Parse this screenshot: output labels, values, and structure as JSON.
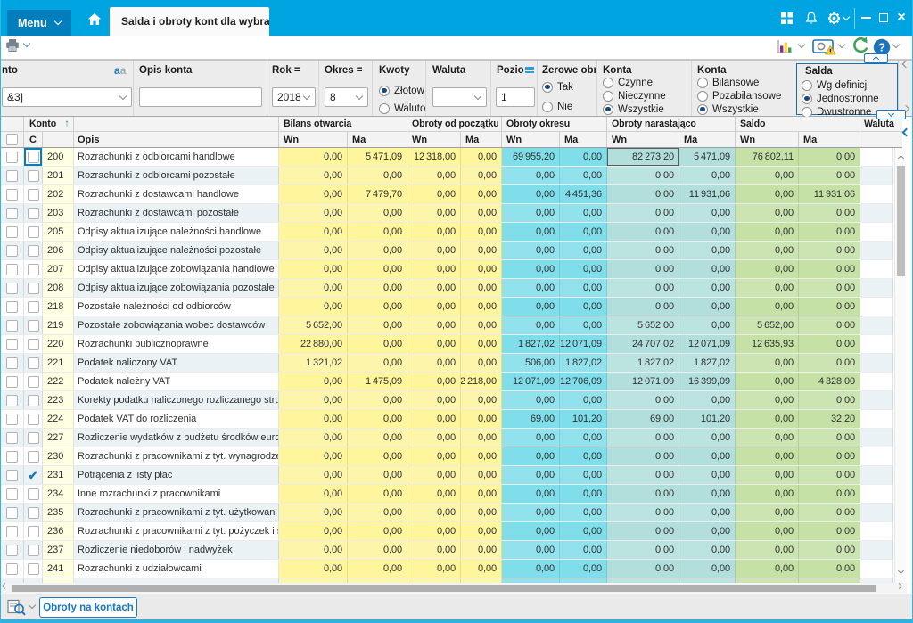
{
  "titlebar": {
    "menu_label": "Menu",
    "tab_title": "Salda i obroty kont dla wybra"
  },
  "filters": {
    "konto": {
      "label": "nto",
      "value": "&3]"
    },
    "opis_konta": {
      "label": "Opis konta",
      "value": ""
    },
    "rok": {
      "label": "Rok =",
      "value": "2018"
    },
    "okres": {
      "label": "Okres =",
      "value": "8"
    },
    "kwoty": {
      "label": "Kwoty",
      "options": [
        "Złotow",
        "Waluto"
      ],
      "selected": "Złotow"
    },
    "waluta": {
      "label": "Waluta",
      "value": ""
    },
    "poziom": {
      "label": "Pozio",
      "value": "1"
    },
    "zerowe_obroty": {
      "label": "Zerowe obro",
      "options": [
        "Tak",
        "Nie"
      ],
      "selected": "Tak"
    },
    "konta_aktywnosc": {
      "label": "Konta",
      "options": [
        "Czynne",
        "Nieczynne",
        "Wszystkie"
      ],
      "selected": "Wszystkie"
    },
    "konta_typ": {
      "label": "Konta",
      "options": [
        "Bilansowe",
        "Pozabilansowe",
        "Wszystkie"
      ],
      "selected": "Wszystkie"
    },
    "salda": {
      "label": "Salda",
      "options": [
        "Wg definicji",
        "Jednostronne",
        "Dwustronne"
      ],
      "selected": "Jednostronne"
    }
  },
  "table": {
    "groups": {
      "konto": "Konto",
      "bilans_otwarcia": "Bilans otwarcia",
      "obroty_od_poczatku": "Obroty od początku r",
      "obroty_okresu": "Obroty okresu",
      "obroty_narastajaco": "Obroty narastająco",
      "saldo": "Saldo",
      "waluta": "Waluta"
    },
    "subheaders": {
      "c": "C",
      "opis": "Opis",
      "wn": "Wn",
      "ma": "Ma"
    },
    "focused_account": "200",
    "checked_account": "231",
    "rows": [
      {
        "konto": "200",
        "opis": "Rozrachunki z odbiorcami handlowe",
        "values": [
          "0,00",
          "5 471,09",
          "12 318,00",
          "0,00",
          "69 955,20",
          "0,00",
          "82 273,20",
          "5 471,09",
          "76 802,11",
          "0,00"
        ]
      },
      {
        "konto": "201",
        "opis": "Rozrachunki z odbiorcami pozostałe",
        "values": [
          "0,00",
          "0,00",
          "0,00",
          "0,00",
          "0,00",
          "0,00",
          "0,00",
          "0,00",
          "0,00",
          "0,00"
        ]
      },
      {
        "konto": "202",
        "opis": "Rozrachunki z dostawcami handlowe",
        "values": [
          "0,00",
          "7 479,70",
          "0,00",
          "0,00",
          "0,00",
          "4 451,36",
          "0,00",
          "11 931,06",
          "0,00",
          "11 931,06"
        ]
      },
      {
        "konto": "203",
        "opis": "Rozrachunki z dostawcami pozostałe",
        "values": [
          "0,00",
          "0,00",
          "0,00",
          "0,00",
          "0,00",
          "0,00",
          "0,00",
          "0,00",
          "0,00",
          "0,00"
        ]
      },
      {
        "konto": "205",
        "opis": "Odpisy aktualizujące należności handlowe",
        "values": [
          "0,00",
          "0,00",
          "0,00",
          "0,00",
          "0,00",
          "0,00",
          "0,00",
          "0,00",
          "0,00",
          "0,00"
        ]
      },
      {
        "konto": "206",
        "opis": "Odpisy aktualizujące należności pozostałe",
        "values": [
          "0,00",
          "0,00",
          "0,00",
          "0,00",
          "0,00",
          "0,00",
          "0,00",
          "0,00",
          "0,00",
          "0,00"
        ]
      },
      {
        "konto": "207",
        "opis": "Odpisy aktualizujące zobowiązania handlowe",
        "values": [
          "0,00",
          "0,00",
          "0,00",
          "0,00",
          "0,00",
          "0,00",
          "0,00",
          "0,00",
          "0,00",
          "0,00"
        ]
      },
      {
        "konto": "208",
        "opis": "Odpisy aktualizujące zobowiązania pozostałe",
        "values": [
          "0,00",
          "0,00",
          "0,00",
          "0,00",
          "0,00",
          "0,00",
          "0,00",
          "0,00",
          "0,00",
          "0,00"
        ]
      },
      {
        "konto": "218",
        "opis": "Pozostałe należności od odbiorców",
        "values": [
          "0,00",
          "0,00",
          "0,00",
          "0,00",
          "0,00",
          "0,00",
          "0,00",
          "0,00",
          "0,00",
          "0,00"
        ]
      },
      {
        "konto": "219",
        "opis": "Pozostałe zobowiązania wobec dostawców",
        "values": [
          "5 652,00",
          "0,00",
          "0,00",
          "0,00",
          "0,00",
          "0,00",
          "5 652,00",
          "0,00",
          "5 652,00",
          "0,00"
        ]
      },
      {
        "konto": "220",
        "opis": "Rozrachunki publicznoprawne",
        "values": [
          "22 880,00",
          "0,00",
          "0,00",
          "0,00",
          "1 827,02",
          "12 071,09",
          "24 707,02",
          "12 071,09",
          "12 635,93",
          "0,00"
        ]
      },
      {
        "konto": "221",
        "opis": "Podatek naliczony VAT",
        "values": [
          "1 321,02",
          "0,00",
          "0,00",
          "0,00",
          "506,00",
          "1 827,02",
          "1 827,02",
          "1 827,02",
          "0,00",
          "0,00"
        ]
      },
      {
        "konto": "222",
        "opis": "Podatek należny VAT",
        "values": [
          "0,00",
          "1 475,09",
          "0,00",
          "2 218,00",
          "12 071,09",
          "12 706,09",
          "12 071,09",
          "16 399,09",
          "0,00",
          "4 328,00"
        ]
      },
      {
        "konto": "223",
        "opis": "Korekty podatku naliczonego rozliczanego stru",
        "values": [
          "0,00",
          "0,00",
          "0,00",
          "0,00",
          "0,00",
          "0,00",
          "0,00",
          "0,00",
          "0,00",
          "0,00"
        ]
      },
      {
        "konto": "224",
        "opis": "Podatek VAT do rozliczenia",
        "values": [
          "0,00",
          "0,00",
          "0,00",
          "0,00",
          "69,00",
          "101,20",
          "69,00",
          "101,20",
          "0,00",
          "32,20"
        ]
      },
      {
        "konto": "227",
        "opis": "Rozliczenie wydatków z budżetu środków euro",
        "values": [
          "0,00",
          "0,00",
          "0,00",
          "0,00",
          "0,00",
          "0,00",
          "0,00",
          "0,00",
          "0,00",
          "0,00"
        ]
      },
      {
        "konto": "230",
        "opis": "Rozrachunki z pracownikami z tyt. wynagrodze",
        "values": [
          "0,00",
          "0,00",
          "0,00",
          "0,00",
          "0,00",
          "0,00",
          "0,00",
          "0,00",
          "0,00",
          "0,00"
        ]
      },
      {
        "konto": "231",
        "opis": "Potrącenia z listy płac",
        "checked": true,
        "values": [
          "0,00",
          "0,00",
          "0,00",
          "0,00",
          "0,00",
          "0,00",
          "0,00",
          "0,00",
          "0,00",
          "0,00"
        ]
      },
      {
        "konto": "234",
        "opis": "Inne rozrachunki z pracownikami",
        "values": [
          "0,00",
          "0,00",
          "0,00",
          "0,00",
          "0,00",
          "0,00",
          "0,00",
          "0,00",
          "0,00",
          "0,00"
        ]
      },
      {
        "konto": "235",
        "opis": "Rozrachunki z pracownikami z tyt. użytkowani",
        "values": [
          "0,00",
          "0,00",
          "0,00",
          "0,00",
          "0,00",
          "0,00",
          "0,00",
          "0,00",
          "0,00",
          "0,00"
        ]
      },
      {
        "konto": "236",
        "opis": "Rozrachunki z pracownikami z tyt. pożyczek i s",
        "values": [
          "0,00",
          "0,00",
          "0,00",
          "0,00",
          "0,00",
          "0,00",
          "0,00",
          "0,00",
          "0,00",
          "0,00"
        ]
      },
      {
        "konto": "237",
        "opis": "Rozliczenie niedoborów i nadwyżek",
        "values": [
          "0,00",
          "0,00",
          "0,00",
          "0,00",
          "0,00",
          "0,00",
          "0,00",
          "0,00",
          "0,00",
          "0,00"
        ]
      },
      {
        "konto": "241",
        "opis": "Rozrachunki z udziałowcami",
        "values": [
          "0,00",
          "0,00",
          "0,00",
          "0,00",
          "0,00",
          "0,00",
          "0,00",
          "0,00",
          "0,00",
          "0,00"
        ]
      }
    ]
  },
  "bottombar": {
    "button_label": "Obroty na kontach"
  },
  "colors": {
    "titlebar": "#00a4e1",
    "accent_blue": "#017ebb",
    "link_blue": "#1779c4",
    "col_yellow": "#fff59d",
    "col_cyan": "#80deea",
    "col_teal": "#b2dfdb",
    "col_green": "#c5e1a5"
  }
}
